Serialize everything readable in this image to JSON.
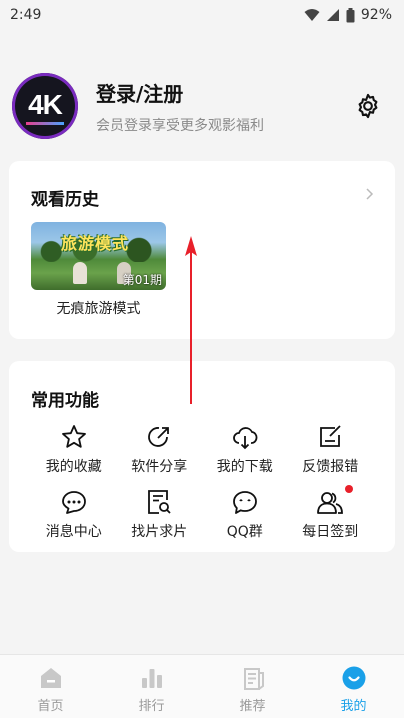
{
  "status": {
    "time": "2:49",
    "battery": "92%"
  },
  "profile": {
    "avatar_text": "4K",
    "title": "登录/注册",
    "subtitle": "会员登录享受更多观影福利"
  },
  "history": {
    "title": "观看历史",
    "items": [
      {
        "label": "无痕旅游模式",
        "episode": "第01期",
        "thumb_text": "旅游模式"
      }
    ]
  },
  "functions": {
    "title": "常用功能",
    "items": [
      {
        "label": "我的收藏",
        "icon": "star-icon"
      },
      {
        "label": "软件分享",
        "icon": "share-icon"
      },
      {
        "label": "我的下载",
        "icon": "cloud-download-icon"
      },
      {
        "label": "反馈报错",
        "icon": "feedback-edit-icon"
      },
      {
        "label": "消息中心",
        "icon": "message-icon"
      },
      {
        "label": "找片求片",
        "icon": "search-document-icon"
      },
      {
        "label": "QQ群",
        "icon": "chat-group-icon"
      },
      {
        "label": "每日签到",
        "icon": "users-checkin-icon"
      }
    ]
  },
  "tabs": [
    {
      "label": "首页",
      "icon": "home-icon"
    },
    {
      "label": "排行",
      "icon": "ranking-icon"
    },
    {
      "label": "推荐",
      "icon": "recommend-icon"
    },
    {
      "label": "我的",
      "icon": "profile-icon",
      "active": true
    }
  ],
  "colors": {
    "accent": "#1aa0e8",
    "badge": "#e8202a",
    "arrow": "#e8202a"
  }
}
